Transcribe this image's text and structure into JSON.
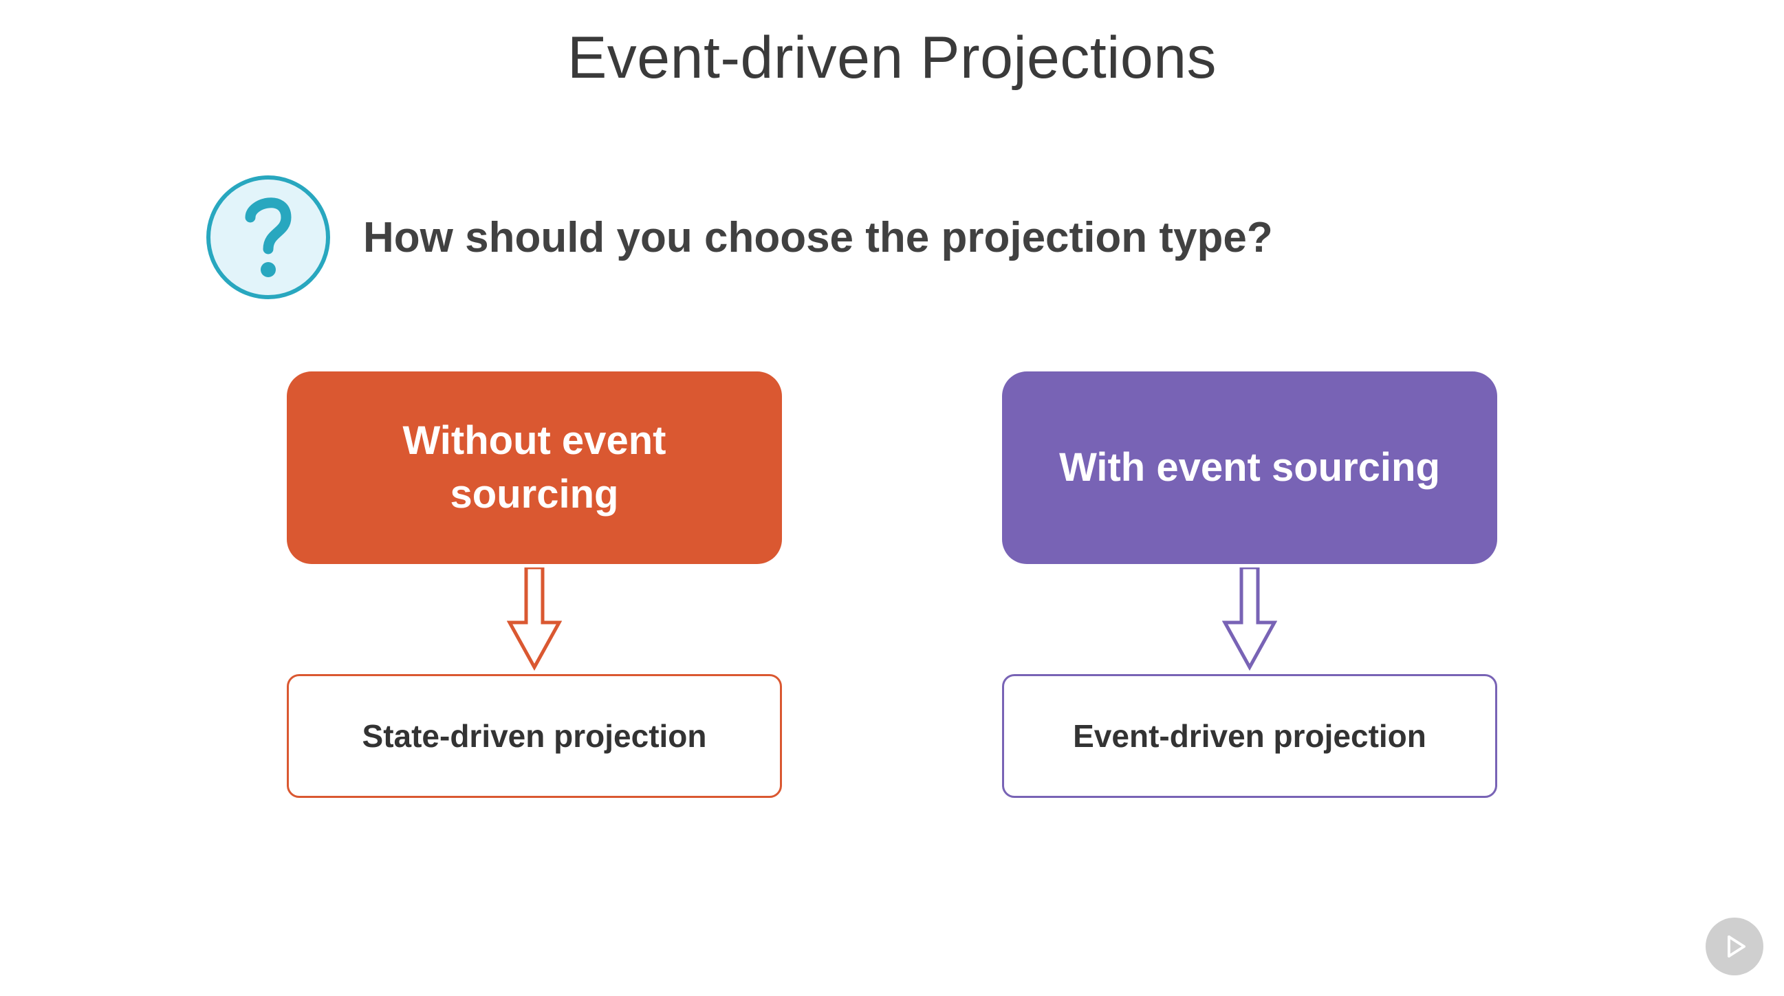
{
  "title": "Event-driven Projections",
  "question": "How should you choose the projection type?",
  "colors": {
    "orange": "#da5831",
    "purple": "#7863b5",
    "question_ring": "#28a7bf",
    "question_fill": "#e2f4fa"
  },
  "columns": {
    "left": {
      "heading": "Without event sourcing",
      "result": "State-driven projection"
    },
    "right": {
      "heading": "With event sourcing",
      "result": "Event-driven projection"
    }
  }
}
